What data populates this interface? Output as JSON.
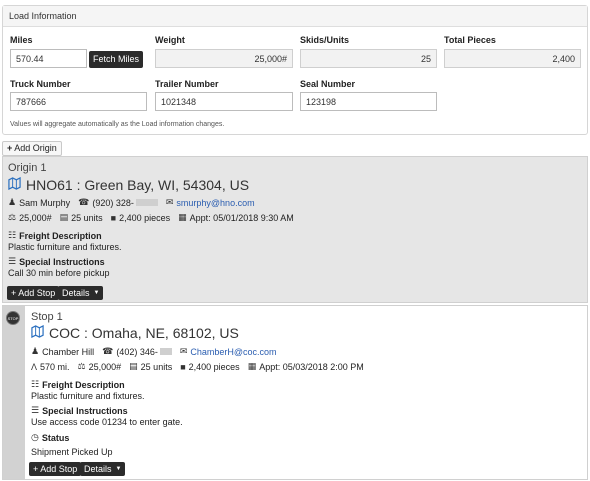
{
  "load_info": {
    "header": "Load Information",
    "miles_label": "Miles",
    "miles_value": "570.44",
    "fetch_miles": "Fetch Miles",
    "weight_label": "Weight",
    "weight_value": "25,000#",
    "skids_label": "Skids/Units",
    "skids_value": "25",
    "pieces_label": "Total Pieces",
    "pieces_value": "2,400",
    "truck_label": "Truck Number",
    "truck_value": "787666",
    "trailer_label": "Trailer Number",
    "trailer_value": "1021348",
    "seal_label": "Seal Number",
    "seal_value": "123198",
    "hint": "Values will aggregate automatically as the Load information changes."
  },
  "add_origin": "Add Origin",
  "origin": {
    "title": "Origin 1",
    "location": "HNO61 : Green Bay, WI, 54304, US",
    "contact": "Sam Murphy",
    "phone": "(920) 328-",
    "email": "smurphy@hno.com",
    "weight": "25,000#",
    "units": "25 units",
    "pieces": "2,400 pieces",
    "appt": "Appt: 05/01/2018 9:30 AM",
    "freight_label": "Freight Description",
    "freight_text": "Plastic furniture and fixtures.",
    "instr_label": "Special Instructions",
    "instr_text": "Call 30 min before pickup",
    "add_stop": "Add Stop",
    "details": "Details"
  },
  "stop": {
    "badge": "STOP",
    "title": "Stop 1",
    "location": "COC : Omaha, NE, 68102, US",
    "contact": "Chamber Hill",
    "phone": "(402) 346-",
    "email": "ChamberH@coc.com",
    "miles": "570 mi.",
    "weight": "25,000#",
    "units": "25 units",
    "pieces": "2,400 pieces",
    "appt": "Appt: 05/03/2018 2:00 PM",
    "freight_label": "Freight Description",
    "freight_text": "Plastic furniture and fixtures.",
    "instr_label": "Special Instructions",
    "instr_text": "Use access code 01234 to enter gate.",
    "status_label": "Status",
    "status_text": "Shipment Picked Up",
    "add_stop": "Add Stop",
    "details": "Details"
  },
  "icons": {
    "map": "map-icon",
    "user": "user-icon",
    "phone": "phone-icon",
    "envelope": "envelope-icon",
    "scale": "scale-icon",
    "units": "units-icon",
    "pieces": "pieces-icon",
    "calendar": "calendar-icon",
    "clipboard": "clipboard-icon",
    "list": "list-icon",
    "road": "road-icon",
    "clock": "clock-icon",
    "plus": "plus-icon",
    "caret": "caret-down-icon"
  },
  "colors": {
    "link": "#2a5db0",
    "dark_button": "#2b2b2b",
    "origin_bg": "#e6e6e6",
    "map_icon": "#2a6fbf"
  }
}
